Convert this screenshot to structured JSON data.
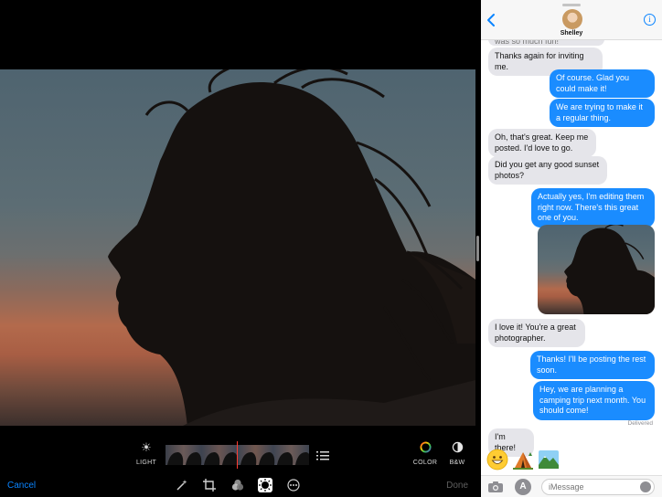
{
  "photos": {
    "tools": {
      "light_label": "LIGHT",
      "color_label": "COLOR",
      "bw_label": "B&W"
    },
    "toolbar": {
      "cancel_label": "Cancel",
      "done_label": "Done"
    },
    "icons": [
      "sun-icon",
      "list-icon",
      "color-wheel-icon",
      "half-circle-icon",
      "magic-wand-icon",
      "crop-icon",
      "filters-icon",
      "adjust-icon",
      "more-icon"
    ]
  },
  "messages": {
    "contact_name": "Shelley",
    "thread": [
      {
        "dir": "in",
        "text": "was so much fun!"
      },
      {
        "dir": "in",
        "text": "Thanks again for inviting me."
      },
      {
        "dir": "out",
        "text": "Of course. Glad you could make it!"
      },
      {
        "dir": "out",
        "text": "We are trying to make it a regular thing."
      },
      {
        "dir": "in",
        "text": "Oh, that's great. Keep me posted. I'd love to go."
      },
      {
        "dir": "in",
        "text": "Did you get any good sunset photos?"
      },
      {
        "dir": "out",
        "text": "Actually yes, I'm editing them right now. There's this great one of you."
      },
      {
        "dir": "in",
        "text": "I love it! You're a great photographer."
      },
      {
        "dir": "out",
        "text": "Thanks! I'll be posting the rest soon."
      },
      {
        "dir": "out",
        "text": "Hey, we are planning a camping trip next month. You should come!"
      },
      {
        "dir": "in",
        "text": "I'm there!"
      }
    ],
    "delivered_label": "Delivered",
    "stickers": [
      "smiley-emoji",
      "camping-tent-emoji",
      "mountain-landscape-emoji"
    ],
    "compose": {
      "placeholder": "iMessage"
    }
  },
  "colors": {
    "accent": "#0a84ff",
    "outgoing_bubble": "#1a8cff",
    "incoming_bubble": "#e5e5ea",
    "needle": "#ff3b30"
  }
}
